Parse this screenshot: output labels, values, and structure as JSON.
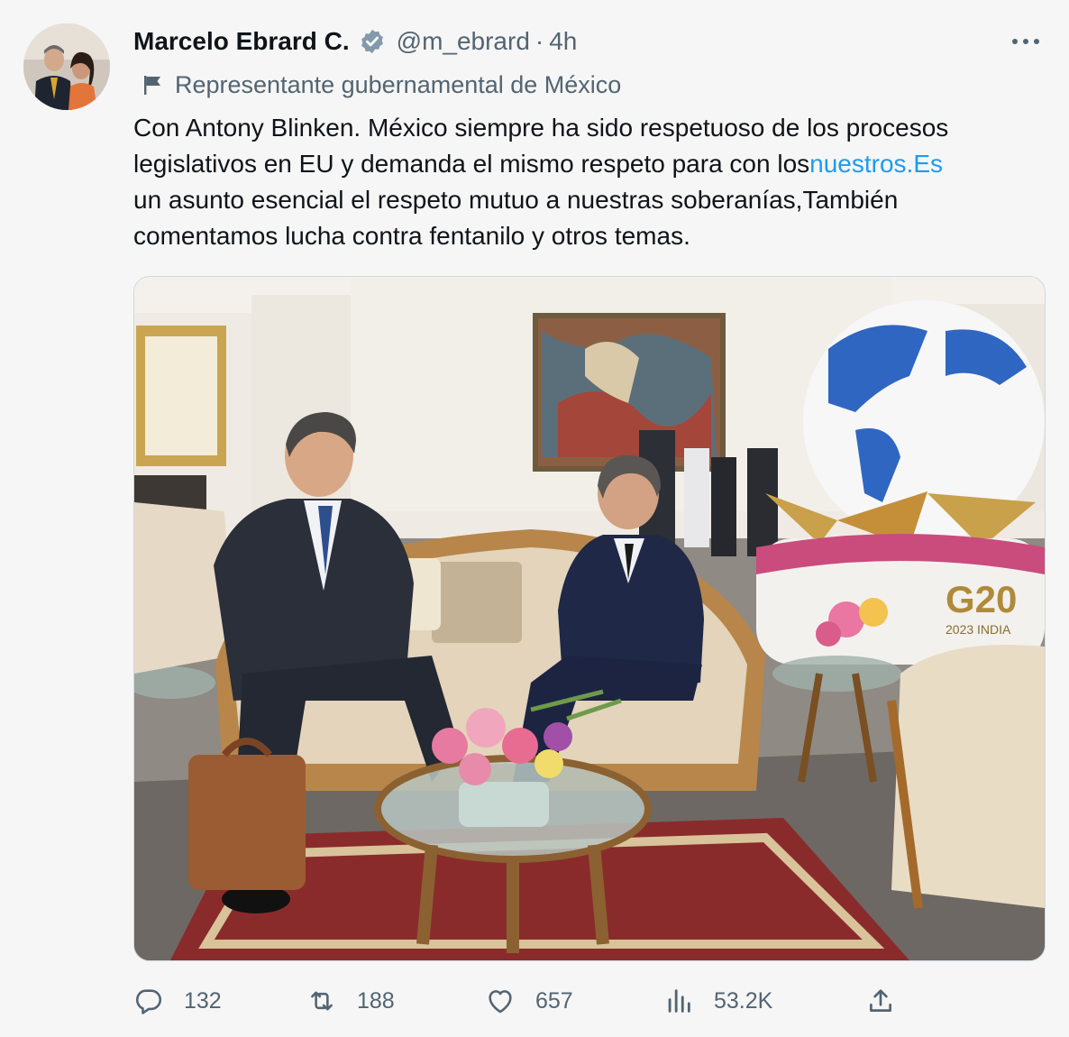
{
  "author": {
    "name": "Marcelo Ebrard C.",
    "handle": "@m_ebrard",
    "separator": "·",
    "time": "4h",
    "label": "Representante gubernamental de México"
  },
  "tweet": {
    "line1": "Con Antony Blinken. México siempre ha sido respetuoso de los procesos",
    "line2_start": "legislativos en EU y demanda el mismo respeto para con los",
    "line2_link": "nuestros.Es",
    "line3": "un asunto esencial el respeto mutuo a nuestras soberanías,También",
    "line4": "comentamos lucha contra fentanilo y otros temas."
  },
  "media": {
    "banner_text": "G20",
    "banner_year": "2023 INDIA"
  },
  "actions": {
    "replies": "132",
    "reposts": "188",
    "likes": "657",
    "views": "53.2K"
  },
  "icons": {
    "verified": "verified-badge-icon",
    "more": "more-dots-icon",
    "flag": "government-flag-icon",
    "reply": "reply-icon",
    "repost": "repost-icon",
    "like": "heart-icon",
    "views": "views-chart-icon",
    "share": "share-icon"
  },
  "colors": {
    "link": "#1d9bf0",
    "secondary": "#536471",
    "text": "#0f1419",
    "verified": "#829aab"
  }
}
